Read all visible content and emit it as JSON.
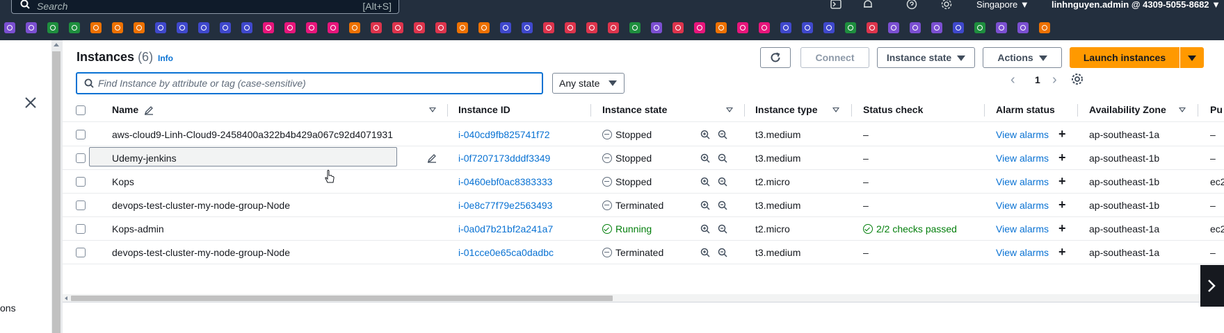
{
  "topnav": {
    "search_placeholder": "Search",
    "search_shortcut": "[Alt+S]",
    "icons": [
      "cloudshell-icon",
      "bell-icon",
      "help-icon",
      "gear-icon"
    ],
    "region": "Singapore ▼",
    "account": "linhnguyen.admin @ 4309-5055-8682 ▼"
  },
  "favorites": {
    "colors": [
      "#7b4fd1",
      "#7b4fd1",
      "#1e8e3e",
      "#1e8e3e",
      "#ed7100",
      "#ed7100",
      "#ed7100",
      "#3f48cc",
      "#3f48cc",
      "#3f48cc",
      "#3f48cc",
      "#3f48cc",
      "#e7157b",
      "#e7157b",
      "#e7157b",
      "#e7157b",
      "#ed7100",
      "#dd344c",
      "#dd344c",
      "#dd344c",
      "#dd344c",
      "#ed7100",
      "#ed7100",
      "#3f48cc",
      "#3f48cc",
      "#dd344c",
      "#dd344c",
      "#dd344c",
      "#dd344c",
      "#1e8e3e",
      "#7b4fd1",
      "#dd344c",
      "#e7157b",
      "#ed7100",
      "#e7157b",
      "#e7157b",
      "#3f48cc",
      "#3f48cc",
      "#3f48cc",
      "#1e8e3e",
      "#dd344c",
      "#7b4fd1",
      "#7b4fd1",
      "#7b4fd1",
      "#3f48cc",
      "#1e8e3e",
      "#7b4fd1",
      "#7b4fd1",
      "#ed7100"
    ]
  },
  "leftpane": {
    "trunc_text": "ons"
  },
  "header": {
    "title": "Instances",
    "count": "(6)",
    "info": "Info",
    "connect": "Connect",
    "instance_state": "Instance state",
    "actions": "Actions",
    "launch": "Launch instances"
  },
  "filter": {
    "placeholder": "Find Instance by attribute or tag (case-sensitive)",
    "state_select": "Any state"
  },
  "pager": {
    "page": "1"
  },
  "table": {
    "columns": {
      "name": "Name",
      "instance_id": "Instance ID",
      "instance_state": "Instance state",
      "instance_type": "Instance type",
      "status_check": "Status check",
      "alarm_status": "Alarm status",
      "availability_zone": "Availability Zone",
      "public": "Pu"
    },
    "rows": [
      {
        "name": "aws-cloud9-Linh-Cloud9-2458400a322b4b429a067c92d4071931",
        "id": "i-040cd9fb825741f72",
        "state": "Stopped",
        "type": "t3.medium",
        "status": "–",
        "alarm": "View alarms",
        "az": "ap-southeast-1a",
        "pub": "–"
      },
      {
        "name": "Udemy-jenkins",
        "id": "i-0f7207173dddf3349",
        "state": "Stopped",
        "type": "t3.medium",
        "status": "–",
        "alarm": "View alarms",
        "az": "ap-southeast-1b",
        "pub": "–"
      },
      {
        "name": "Kops",
        "id": "i-0460ebf0ac8383333",
        "state": "Stopped",
        "type": "t2.micro",
        "status": "–",
        "alarm": "View alarms",
        "az": "ap-southeast-1b",
        "pub": "ec2"
      },
      {
        "name": "devops-test-cluster-my-node-group-Node",
        "id": "i-0e8c77f79e2563493",
        "state": "Terminated",
        "type": "t3.medium",
        "status": "–",
        "alarm": "View alarms",
        "az": "ap-southeast-1b",
        "pub": "–"
      },
      {
        "name": "Kops-admin",
        "id": "i-0a0d7b21bf2a241a7",
        "state": "Running",
        "type": "t2.micro",
        "status": "2/2 checks passed",
        "alarm": "View alarms",
        "az": "ap-southeast-1a",
        "pub": "ec2"
      },
      {
        "name": "devops-test-cluster-my-node-group-Node",
        "id": "i-01cce0e65ca0dadbc",
        "state": "Terminated",
        "type": "t3.medium",
        "status": "–",
        "alarm": "View alarms",
        "az": "ap-southeast-1a",
        "pub": "–"
      }
    ]
  }
}
